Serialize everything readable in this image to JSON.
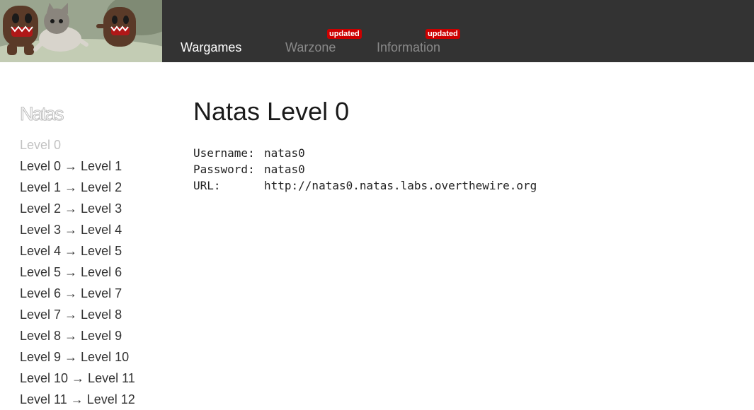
{
  "nav": {
    "items": [
      {
        "label": "Wargames",
        "badge": ""
      },
      {
        "label": "Warzone",
        "badge": "updated"
      },
      {
        "label": "Information",
        "badge": "updated"
      }
    ]
  },
  "sidebar": {
    "title": "Natas",
    "levels": [
      "Level 0",
      "Level 0 → Level 1",
      "Level 1 → Level 2",
      "Level 2 → Level 3",
      "Level 3 → Level 4",
      "Level 4 → Level 5",
      "Level 5 → Level 6",
      "Level 6 → Level 7",
      "Level 7 → Level 8",
      "Level 8 → Level 9",
      "Level 9 → Level 10",
      "Level 10 → Level 11",
      "Level 11 → Level 12"
    ]
  },
  "main": {
    "title": "Natas Level 0",
    "credentials": {
      "username_label": "Username:",
      "username": "natas0",
      "password_label": "Password:",
      "password": "natas0",
      "url_label": "URL:",
      "url": "http://natas0.natas.labs.overthewire.org"
    }
  },
  "colors": {
    "topbar": "#333333",
    "badge": "#cc0000",
    "nav_active": "#ffffff",
    "nav_inactive": "#8a8a8a",
    "sidebar_current": "#c2c2c2",
    "sidebar_link": "#333333"
  }
}
